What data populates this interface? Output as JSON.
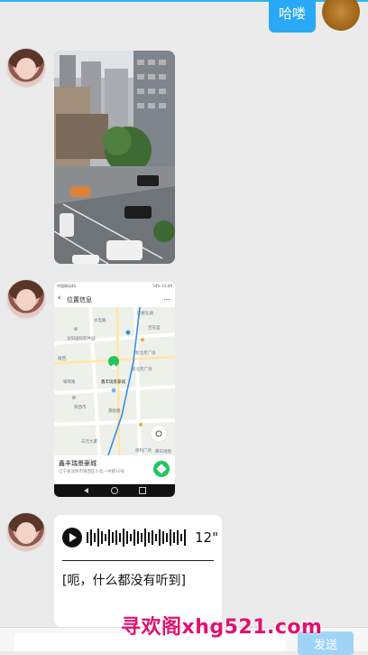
{
  "messages": {
    "sent_greeting": "哈喽"
  },
  "map_card": {
    "status_bar_left": "中国移动4G",
    "status_bar_right": "54% 11:49",
    "title": "位置信息",
    "more_label": "…",
    "back_label": "‹",
    "map_labels": [
      "巴黎北湖",
      "水电路",
      "沈阳国际软件园",
      "陵西",
      "百花里",
      "新北苑广场",
      "铁西市",
      "鑫丰瑞景豪城",
      "新北苑广场",
      "钢琴路",
      "黄姑路",
      "天元大厦",
      "保利广场",
      "腾讯地图"
    ],
    "place_name": "鑫丰瑞景豪城",
    "address": "辽宁省沈阳市铁西区小北一中路10号"
  },
  "voice_message": {
    "duration": "12\"",
    "transcript": "[呃，什么都没有听到]"
  },
  "input_bar": {
    "send_label": "发送"
  },
  "watermark": "寻欢阁xhg521.com",
  "colors": {
    "accent": "#29a9f5",
    "background": "#ebebeb",
    "watermark": "#e0126e",
    "map_green": "#22c55e"
  }
}
